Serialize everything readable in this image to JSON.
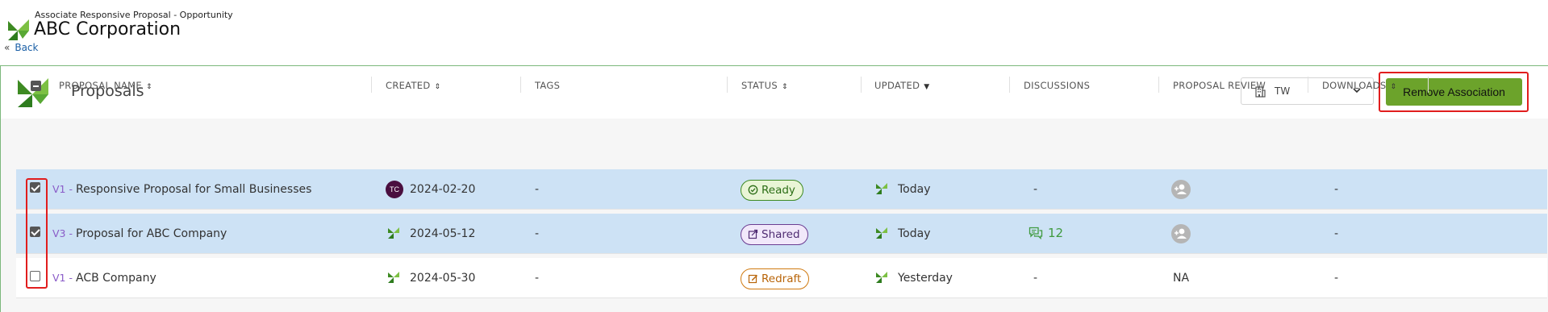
{
  "header": {
    "context": "Associate Responsive Proposal - Opportunity",
    "title": "ABC Corporation",
    "back_chevron": "«",
    "back_label": "Back"
  },
  "panel": {
    "title": "Proposals",
    "tenant_select": {
      "value": "TW",
      "icon": "building-icon"
    },
    "remove_button_label": "Remove Association"
  },
  "table": {
    "columns": [
      {
        "label": "PROPOSAL NAME",
        "sort": "⇕"
      },
      {
        "label": "CREATED",
        "sort": "⇕"
      },
      {
        "label": "TAGS",
        "sort": ""
      },
      {
        "label": "STATUS",
        "sort": "⇕"
      },
      {
        "label": "UPDATED",
        "sort": "▼"
      },
      {
        "label": "DISCUSSIONS",
        "sort": ""
      },
      {
        "label": "PROPOSAL REVIEW",
        "sort": ""
      },
      {
        "label": "DOWNLOADS",
        "sort": "⇕"
      }
    ],
    "header_checkbox": "indeterminate",
    "rows": [
      {
        "checked": true,
        "version": "V1 -",
        "name": "Responsive Proposal for Small Businesses",
        "created_by": "TC",
        "created": "2024-02-20",
        "tags": "-",
        "status": "Ready",
        "updated": "Today",
        "discussions": "-",
        "review": "add-reviewer-icon",
        "downloads": "-"
      },
      {
        "checked": true,
        "version": "V3 -",
        "name": "Proposal for ABC Company",
        "created_by": "leaf-logo",
        "created": "2024-05-12",
        "tags": "-",
        "status": "Shared",
        "updated": "Today",
        "discussions": "12",
        "review": "add-reviewer-icon",
        "downloads": "-"
      },
      {
        "checked": false,
        "version": "V1 -",
        "name": "ACB Company",
        "created_by": "leaf-logo",
        "created": "2024-05-30",
        "tags": "-",
        "status": "Redraft",
        "updated": "Yesterday",
        "discussions": "-",
        "review": "NA",
        "downloads": "-"
      }
    ]
  },
  "colors": {
    "brand_green": "#6ca32b",
    "selected_row": "#cde2f5",
    "highlight_red": "#e11d1d"
  }
}
